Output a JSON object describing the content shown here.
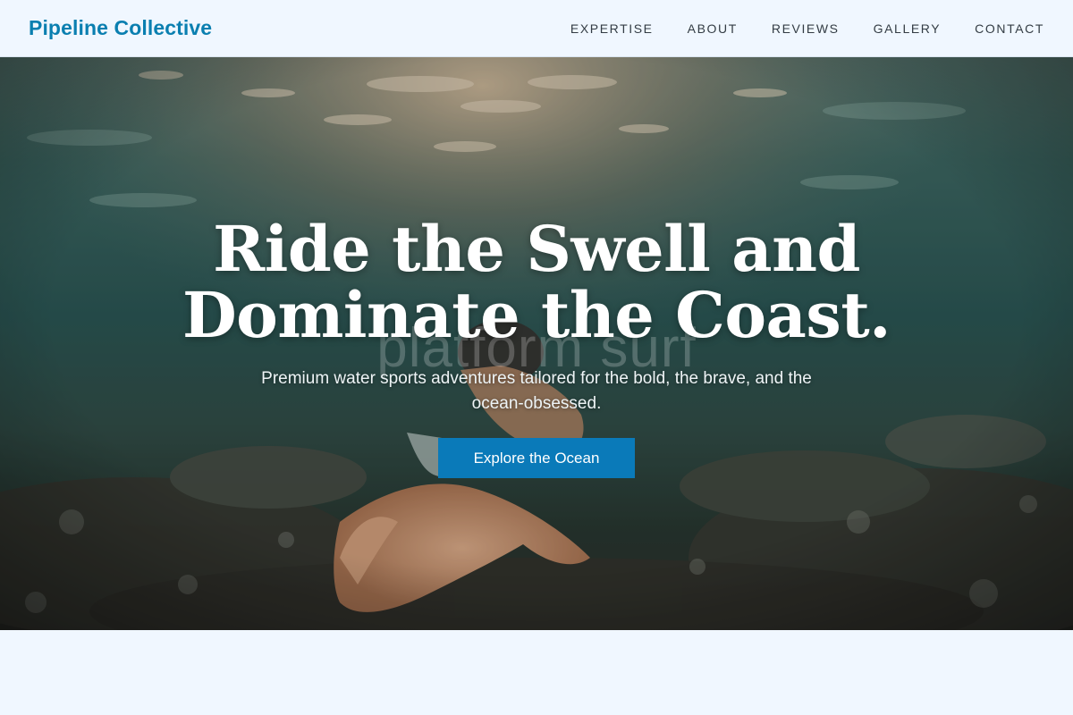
{
  "brand": {
    "name": "Pipeline Collective"
  },
  "nav": {
    "items": [
      "EXPERTISE",
      "ABOUT",
      "REVIEWS",
      "GALLERY",
      "CONTACT"
    ]
  },
  "hero": {
    "title": "Ride the Swell and Dominate the Coast.",
    "subtitle": "Premium water sports adventures tailored for the bold, the brave, and the ocean-obsessed.",
    "cta_label": "Explore the Ocean",
    "watermark": "platform surf",
    "image_subject": "underwater-swimmer-reaching-over-reef"
  },
  "colors": {
    "brand": "#0a7fb0",
    "cta": "#0a7ab9",
    "page_background": "#f0f7ff",
    "nav_text": "#333c44"
  }
}
